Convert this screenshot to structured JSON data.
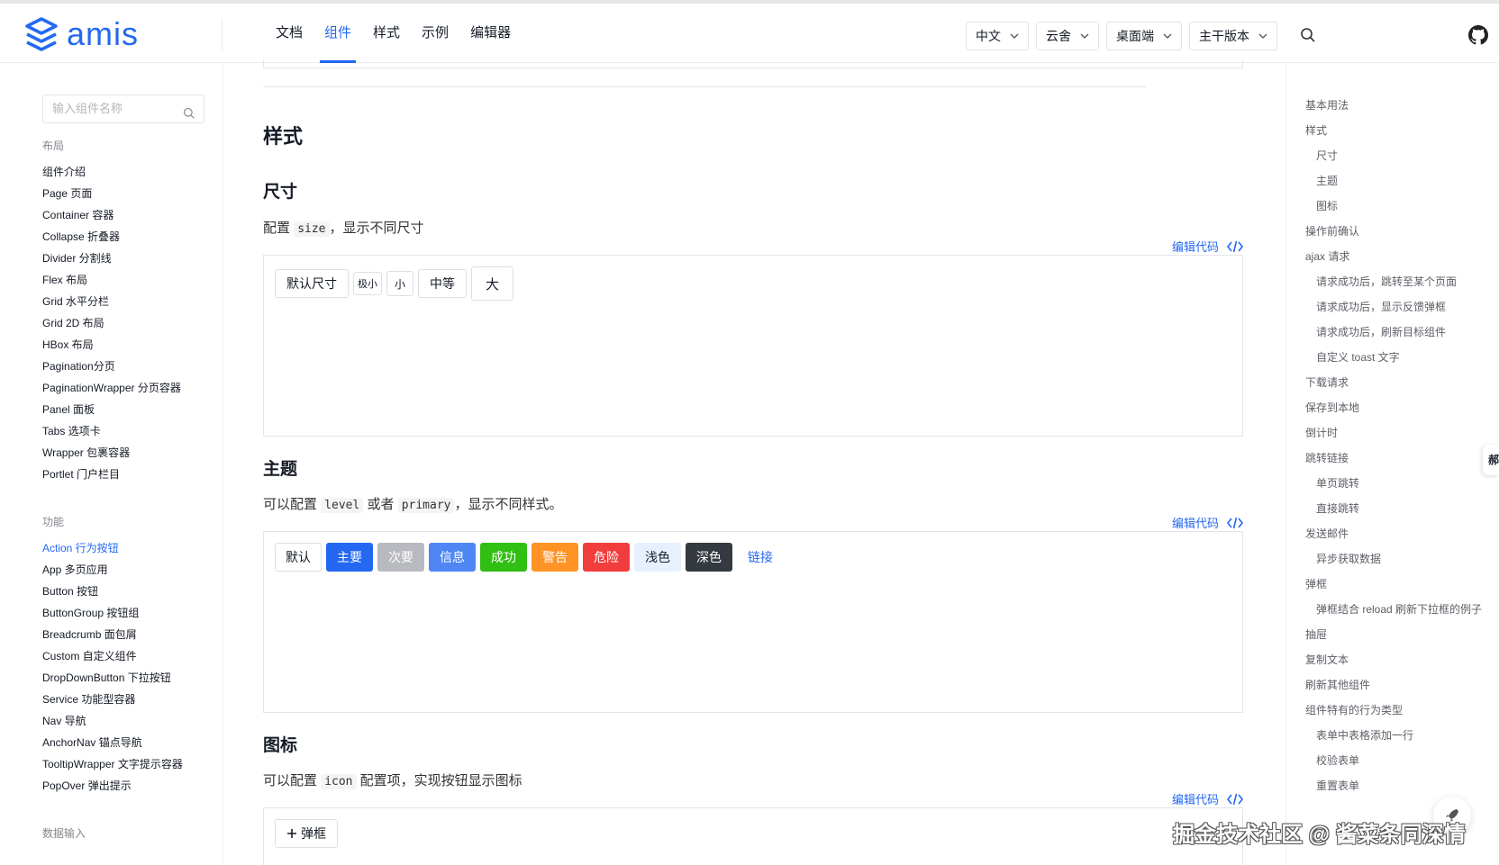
{
  "header": {
    "logo_text": "amis",
    "nav": [
      "文档",
      "组件",
      "样式",
      "示例",
      "编辑器"
    ],
    "nav_active": 1,
    "selects": [
      "中文",
      "云舍",
      "桌面端",
      "主干版本"
    ]
  },
  "sidebar": {
    "search_placeholder": "输入组件名称",
    "group_layout": "布局",
    "layout_items": [
      "组件介绍",
      "Page 页面",
      "Container 容器",
      "Collapse 折叠器",
      "Divider 分割线",
      "Flex 布局",
      "Grid 水平分栏",
      "Grid 2D 布局",
      "HBox 布局",
      "Pagination分页",
      "PaginationWrapper 分页容器",
      "Panel 面板",
      "Tabs 选项卡",
      "Wrapper 包裹容器",
      "Portlet 门户栏目"
    ],
    "group_function": "功能",
    "function_items": [
      "Action 行为按钮",
      "App 多页应用",
      "Button 按钮",
      "ButtonGroup 按钮组",
      "Breadcrumb 面包屑",
      "Custom 自定义组件",
      "DropDownButton 下拉按钮",
      "Service 功能型容器",
      "Nav 导航",
      "AnchorNav 锚点导航",
      "TooltipWrapper 文字提示容器",
      "PopOver 弹出提示"
    ],
    "group_input": "数据输入"
  },
  "main": {
    "section_title": "样式",
    "edit_code": "编辑代码",
    "size": {
      "title": "尺寸",
      "desc_pre": "配置",
      "desc_code": "size",
      "desc_post": "，显示不同尺寸",
      "buttons": [
        "默认尺寸",
        "极小",
        "小",
        "中等",
        "大"
      ]
    },
    "theme": {
      "title": "主题",
      "desc_pre": "可以配置",
      "desc_code1": "level",
      "desc_mid": "或者",
      "desc_code2": "primary",
      "desc_post": "，显示不同样式。",
      "buttons": [
        "默认",
        "主要",
        "次要",
        "信息",
        "成功",
        "警告",
        "危险",
        "浅色",
        "深色",
        "链接"
      ]
    },
    "icon": {
      "title": "图标",
      "desc_pre": "可以配置",
      "desc_code": "icon",
      "desc_post": "配置项，实现按钮显示图标",
      "button": "弹框"
    }
  },
  "theme_colors": {
    "default": [
      "#ffffff",
      "#dcdfe6",
      "#151b26"
    ],
    "primary": [
      "#2468f2",
      "#2468f2",
      "#ffffff"
    ],
    "secondary": [
      "#b8babf",
      "#b8babf",
      "#ffffff"
    ],
    "info": [
      "#4f86f4",
      "#4f86f4",
      "#ffffff"
    ],
    "success": [
      "#30bf13",
      "#30bf13",
      "#ffffff"
    ],
    "warning": [
      "#ff9326",
      "#ff9326",
      "#ffffff"
    ],
    "danger": [
      "#f23d3d",
      "#f23d3d",
      "#ffffff"
    ],
    "light": [
      "#e6f0ff",
      "#e6f0ff",
      "#151b26"
    ],
    "dark": [
      "#343a40",
      "#343a40",
      "#ffffff"
    ]
  },
  "toc": [
    {
      "label": "基本用法",
      "level": 1
    },
    {
      "label": "样式",
      "level": 1
    },
    {
      "label": "尺寸",
      "level": 2
    },
    {
      "label": "主题",
      "level": 2
    },
    {
      "label": "图标",
      "level": 2
    },
    {
      "label": "操作前确认",
      "level": 1
    },
    {
      "label": "ajax 请求",
      "level": 1
    },
    {
      "label": "请求成功后，跳转至某个页面",
      "level": 2
    },
    {
      "label": "请求成功后，显示反馈弹框",
      "level": 2
    },
    {
      "label": "请求成功后，刷新目标组件",
      "level": 2
    },
    {
      "label": "自定义 toast 文字",
      "level": 2
    },
    {
      "label": "下载请求",
      "level": 1
    },
    {
      "label": "保存到本地",
      "level": 1
    },
    {
      "label": "倒计时",
      "level": 1
    },
    {
      "label": "跳转链接",
      "level": 1
    },
    {
      "label": "单页跳转",
      "level": 2
    },
    {
      "label": "直接跳转",
      "level": 2
    },
    {
      "label": "发送邮件",
      "level": 1
    },
    {
      "label": "异步获取数据",
      "level": 2
    },
    {
      "label": "弹框",
      "level": 1
    },
    {
      "label": "弹框结合 reload 刷新下拉框的例子",
      "level": 2
    },
    {
      "label": "抽屉",
      "level": 1
    },
    {
      "label": "复制文本",
      "level": 1
    },
    {
      "label": "刷新其他组件",
      "level": 1
    },
    {
      "label": "组件特有的行为类型",
      "level": 1
    },
    {
      "label": "表单中表格添加一行",
      "level": 2
    },
    {
      "label": "校验表单",
      "level": 2
    },
    {
      "label": "重置表单",
      "level": 2
    }
  ],
  "edge_tab": "郝",
  "watermark": "掘金技术社区 @ 酱菜条同深情"
}
